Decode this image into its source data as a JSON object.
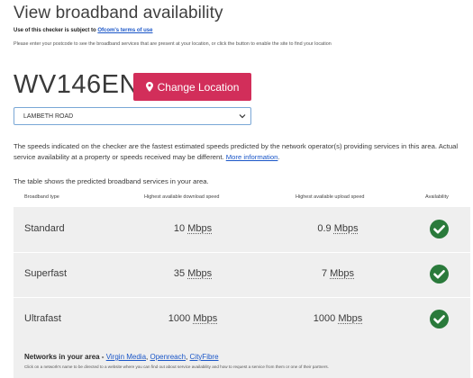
{
  "header": {
    "title": "View broadband availability",
    "terms_prefix": "Use of this checker is subject to ",
    "terms_link": "Ofcom's terms of use",
    "instructions": "Please enter your postcode to see the broadband services that are present at your location, or click the button to enable the site to find your location"
  },
  "location": {
    "postcode": "WV146EN",
    "change_button": "Change Location",
    "address_selected": "LAMBETH ROAD"
  },
  "info": {
    "speeds_text": "The speeds indicated on the checker are the fastest estimated speeds predicted by the network operator(s) providing services in this area. Actual service availability at a property or speeds received may be different. ",
    "more_info_link": "More information",
    "more_info_suffix": ".",
    "table_intro": "The table shows the predicted broadband services in your area."
  },
  "table": {
    "headers": {
      "type": "Broadband type",
      "download": "Highest available download speed",
      "upload": "Highest available upload speed",
      "availability": "Availability"
    },
    "rows": [
      {
        "type": "Standard",
        "download": "10",
        "upload": "0.9",
        "unit": "Mbps",
        "available": true
      },
      {
        "type": "Superfast",
        "download": "35",
        "upload": "7",
        "unit": "Mbps",
        "available": true
      },
      {
        "type": "Ultrafast",
        "download": "1000",
        "upload": "1000",
        "unit": "Mbps",
        "available": true
      }
    ]
  },
  "networks": {
    "label": "Networks in your area - ",
    "links": [
      "Virgin Media",
      "Openreach",
      "CityFibre"
    ],
    "separator": ", ",
    "note": "Click on a network's name to be directed to a website where you can find out about service availability and how to request a service from them or one of their partners."
  },
  "colors": {
    "accent": "#d22e5a",
    "link": "#1a56c8",
    "check": "#2a7a3b",
    "table_bg": "#efefef"
  },
  "icons": {
    "location": "map-pin-icon",
    "dropdown": "chevron-down-icon",
    "available": "check-circle-icon"
  }
}
